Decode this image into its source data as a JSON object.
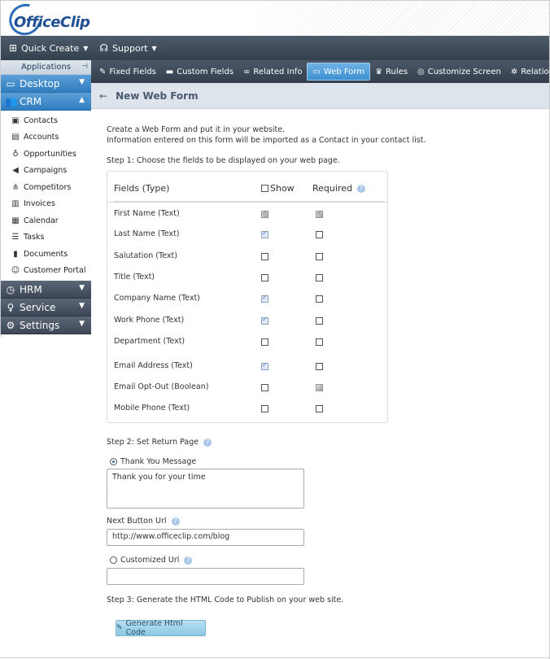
{
  "header": {
    "logo_text": "OfficeClip"
  },
  "topnav": {
    "items": [
      {
        "label": "Quick Create",
        "icon": "plus-doc-icon"
      },
      {
        "label": "Support",
        "icon": "headset-icon"
      }
    ]
  },
  "sidebar": {
    "apps_label": "Applications",
    "sections": {
      "desktop": "Desktop",
      "crm": "CRM",
      "hrm": "HRM",
      "service": "Service",
      "settings": "Settings"
    },
    "crm_items": [
      {
        "label": "Contacts",
        "icon": "contact-card-icon"
      },
      {
        "label": "Accounts",
        "icon": "accounts-icon"
      },
      {
        "label": "Opportunities",
        "icon": "money-bag-icon"
      },
      {
        "label": "Campaigns",
        "icon": "megaphone-icon"
      },
      {
        "label": "Competitors",
        "icon": "sitemap-icon"
      },
      {
        "label": "Invoices",
        "icon": "invoice-icon"
      },
      {
        "label": "Calendar",
        "icon": "calendar-icon"
      },
      {
        "label": "Tasks",
        "icon": "tasks-icon"
      },
      {
        "label": "Documents",
        "icon": "document-icon"
      },
      {
        "label": "Customer Portal",
        "icon": "users-icon"
      }
    ]
  },
  "tabs": [
    {
      "label": "Fixed Fields",
      "icon": "pencil-icon",
      "active": false
    },
    {
      "label": "Custom Fields",
      "icon": "database-icon",
      "active": false
    },
    {
      "label": "Related Info",
      "icon": "binoculars-icon",
      "active": false
    },
    {
      "label": "Web Form",
      "icon": "window-icon",
      "active": true
    },
    {
      "label": "Rules",
      "icon": "award-icon",
      "active": false
    },
    {
      "label": "Customize Screen",
      "icon": "gear-icon",
      "active": false
    },
    {
      "label": "Relations",
      "icon": "cog-icon",
      "active": false
    }
  ],
  "page": {
    "title": "New Web Form",
    "intro_line1": "Create a Web Form and put it in your website.",
    "intro_line2": "Information entered on this form will be imported as a Contact in your contact list.",
    "step1": "Step 1:  Choose the fields to be displayed on your web page.",
    "fields_header": {
      "fields": "Fields (Type)",
      "show": "Show",
      "required": "Required"
    },
    "fields": [
      {
        "name": "First Name (Text)",
        "show": "disabled-checked",
        "required": "disabled-checked"
      },
      {
        "name": "Last Name (Text)",
        "show": "checked",
        "required": "unchecked"
      },
      {
        "name": "Salutation (Text)",
        "show": "unchecked",
        "required": "unchecked"
      },
      {
        "name": "Title (Text)",
        "show": "unchecked",
        "required": "unchecked"
      },
      {
        "name": "Company Name (Text)",
        "show": "checked",
        "required": "unchecked"
      },
      {
        "name": "Work Phone (Text)",
        "show": "checked",
        "required": "unchecked"
      },
      {
        "name": "Department (Text)",
        "show": "unchecked",
        "required": "unchecked"
      },
      {
        "name": "Email Address (Text)",
        "show": "checked",
        "required": "unchecked"
      },
      {
        "name": "Email Opt-Out (Boolean)",
        "show": "unchecked",
        "required": "disabled"
      },
      {
        "name": "Mobile Phone (Text)",
        "show": "unchecked",
        "required": "unchecked"
      }
    ],
    "step2": "Step 2:  Set Return Page",
    "thank_you_label": "Thank You Message",
    "thank_you_value": "Thank you for your time",
    "next_button_label": "Next Button Url",
    "next_button_value": "http://www.officeclip.com/blog",
    "customized_url_label": "Customized Url",
    "customized_url_value": "",
    "step3": "Step 3: Generate the HTML Code to Publish on your web site.",
    "generate_button": "Generate Html Code"
  }
}
